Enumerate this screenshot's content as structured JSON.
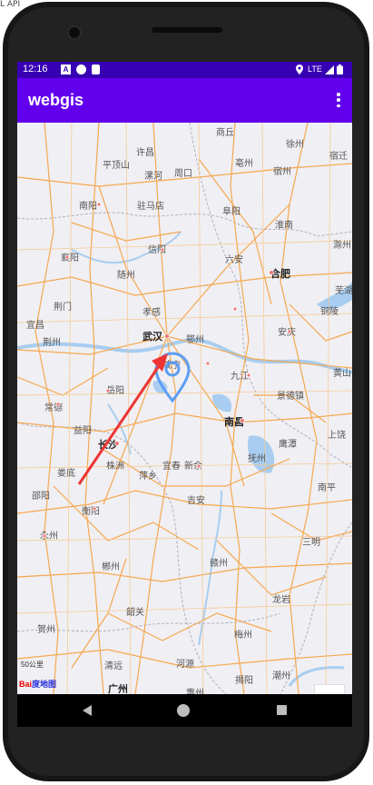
{
  "desk_fragment": "L API",
  "status_bar": {
    "time": "12:16",
    "network": "LTE"
  },
  "app_bar": {
    "title": "webgis"
  },
  "map": {
    "provider_logo_red": "Bai",
    "provider_logo_blue": "度地图",
    "scale_text": "50公里",
    "zoom_in": "+",
    "zoom_out": "−",
    "cities": [
      {
        "name": "商丘"
      },
      {
        "name": "徐州"
      },
      {
        "name": "宿迁"
      },
      {
        "name": "平顶山"
      },
      {
        "name": "许昌"
      },
      {
        "name": "亳州"
      },
      {
        "name": "漯河"
      },
      {
        "name": "周口"
      },
      {
        "name": "宿州"
      },
      {
        "name": "南阳"
      },
      {
        "name": "驻马店"
      },
      {
        "name": "阜阳"
      },
      {
        "name": "淮南"
      },
      {
        "name": "滁州"
      },
      {
        "name": "襄阳"
      },
      {
        "name": "信阳"
      },
      {
        "name": "六安"
      },
      {
        "name": "合肥"
      },
      {
        "name": "随州"
      },
      {
        "name": "荆门"
      },
      {
        "name": "孝感"
      },
      {
        "name": "芜湖"
      },
      {
        "name": "宜昌"
      },
      {
        "name": "铜陵"
      },
      {
        "name": "武汉"
      },
      {
        "name": "鄂州"
      },
      {
        "name": "安庆"
      },
      {
        "name": "荆州"
      },
      {
        "name": "咸宁"
      },
      {
        "name": "九江"
      },
      {
        "name": "黄山"
      },
      {
        "name": "岳阳"
      },
      {
        "name": "景德镇"
      },
      {
        "name": "常德"
      },
      {
        "name": "南昌"
      },
      {
        "name": "上饶"
      },
      {
        "name": "益阳"
      },
      {
        "name": "鹰潭"
      },
      {
        "name": "长沙"
      },
      {
        "name": "抚州"
      },
      {
        "name": "娄底"
      },
      {
        "name": "株洲"
      },
      {
        "name": "萍乡"
      },
      {
        "name": "宜春"
      },
      {
        "name": "新余"
      },
      {
        "name": "南平"
      },
      {
        "name": "邵阳"
      },
      {
        "name": "吉安"
      },
      {
        "name": "衡阳"
      },
      {
        "name": "永州"
      },
      {
        "name": "三明"
      },
      {
        "name": "赣州"
      },
      {
        "name": "郴州"
      },
      {
        "name": "龙岩"
      },
      {
        "name": "韶关"
      },
      {
        "name": "贺州"
      },
      {
        "name": "梅州"
      },
      {
        "name": "清远"
      },
      {
        "name": "河源"
      },
      {
        "name": "揭阳"
      },
      {
        "name": "潮州"
      },
      {
        "name": "广州"
      },
      {
        "name": "惠州"
      }
    ]
  },
  "colors": {
    "status_bar": "#3700b3",
    "app_bar": "#6200ee",
    "road": "#f5a84f",
    "water": "#a8cdf0",
    "marker": "#5b9ef5",
    "arrow": "#ee3333"
  }
}
